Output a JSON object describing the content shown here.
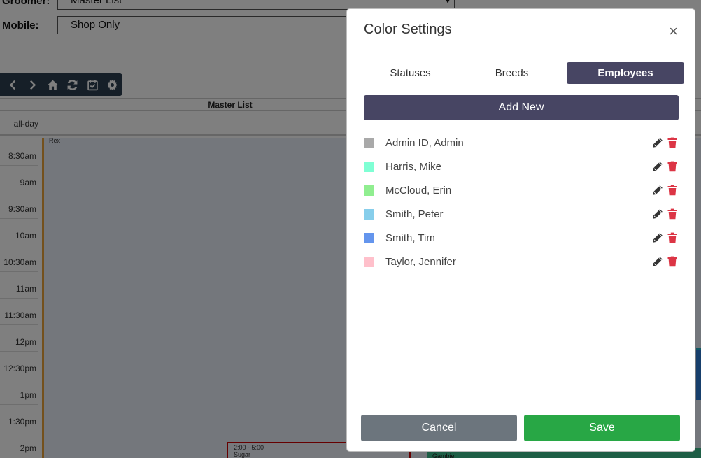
{
  "filters": {
    "groomer_label": "Groomer:",
    "groomer_value": "Master List",
    "mobile_label": "Mobile:",
    "mobile_value": "Shop Only"
  },
  "toolbar": {
    "icons": [
      "prev-icon",
      "next-icon",
      "home-icon",
      "refresh-icon",
      "calendar-check-icon",
      "gear-icon"
    ]
  },
  "calendar": {
    "column_title": "Master List",
    "allday_label": "all-day",
    "time_slots": [
      "8:30am",
      "9am",
      "9:30am",
      "10am",
      "10:30am",
      "11am",
      "11:30am",
      "12pm",
      "12:30pm",
      "1pm",
      "1:30pm",
      "2pm"
    ],
    "events": {
      "top_label": "Rex",
      "red_time": "2:00 - 5:00",
      "red_title": "Sugar",
      "green_title": "Gambier"
    }
  },
  "modal": {
    "title": "Color Settings",
    "close": "×",
    "tabs": [
      {
        "label": "Statuses",
        "active": false
      },
      {
        "label": "Breeds",
        "active": false
      },
      {
        "label": "Employees",
        "active": true
      }
    ],
    "add_new_label": "Add New",
    "employees": [
      {
        "name": "Admin ID, Admin",
        "color": "#a9a9a9"
      },
      {
        "name": "Harris, Mike",
        "color": "#7fffd4"
      },
      {
        "name": "McCloud, Erin",
        "color": "#90ee90"
      },
      {
        "name": "Smith, Peter",
        "color": "#87ceeb"
      },
      {
        "name": "Smith, Tim",
        "color": "#6495ed"
      },
      {
        "name": "Taylor, Jennifer",
        "color": "#ffc0cb"
      }
    ],
    "cancel_label": "Cancel",
    "save_label": "Save"
  },
  "colors": {
    "primary_dark": "#474563",
    "delete_red": "#dc3545",
    "save_green": "#28a745",
    "cancel_gray": "#6c757d"
  }
}
